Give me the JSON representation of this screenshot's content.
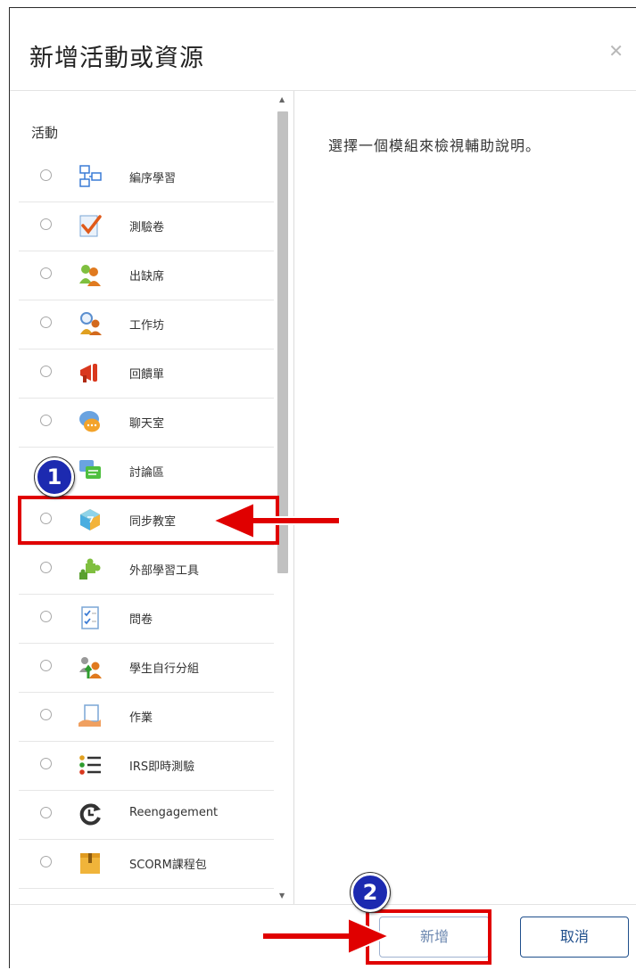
{
  "dialog": {
    "title": "新增活動或資源",
    "close_icon": "close-icon"
  },
  "sidebar": {
    "section_title": "活動",
    "items": [
      {
        "label": "編序學習",
        "icon": "lesson-icon"
      },
      {
        "label": "測驗卷",
        "icon": "quiz-icon"
      },
      {
        "label": "出缺席",
        "icon": "attendance-icon"
      },
      {
        "label": "工作坊",
        "icon": "workshop-icon"
      },
      {
        "label": "回饋單",
        "icon": "feedback-icon"
      },
      {
        "label": "聊天室",
        "icon": "chat-icon"
      },
      {
        "label": "討論區",
        "icon": "forum-icon"
      },
      {
        "label": "同步教室",
        "icon": "virtual-classroom-icon"
      },
      {
        "label": "外部學習工具",
        "icon": "external-tool-icon"
      },
      {
        "label": "問卷",
        "icon": "questionnaire-icon"
      },
      {
        "label": "學生自行分組",
        "icon": "group-choice-icon"
      },
      {
        "label": "作業",
        "icon": "assignment-icon"
      },
      {
        "label": "IRS即時測驗",
        "icon": "irs-list-icon"
      },
      {
        "label": "Reengagement",
        "icon": "reengagement-icon"
      },
      {
        "label": "SCORM課程包",
        "icon": "scorm-package-icon"
      },
      {
        "label": "",
        "icon": "partial-item-icon"
      }
    ]
  },
  "help": {
    "text": "選擇一個模組來檢視輔助說明。"
  },
  "footer": {
    "add_label": "新增",
    "cancel_label": "取消"
  },
  "annotations": {
    "step1": "1",
    "step2": "2",
    "color": "#e00000",
    "badge_color": "#1c2ab0"
  }
}
